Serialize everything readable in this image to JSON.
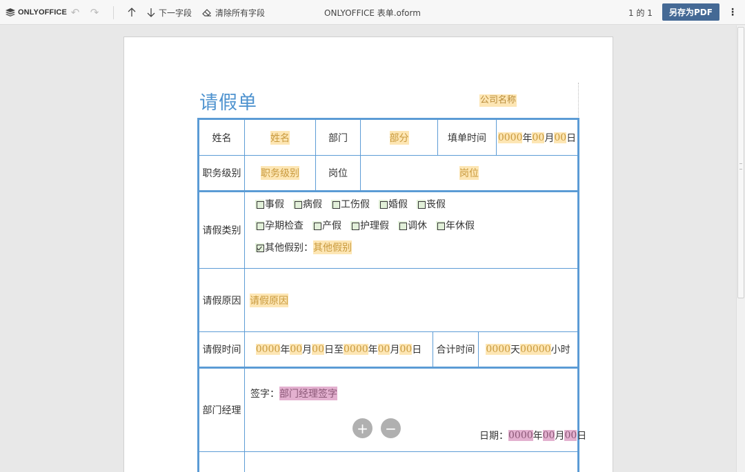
{
  "toolbar": {
    "logo_text": "ONLYOFFICE",
    "next_field": "下一字段",
    "clear_fields": "清除所有字段",
    "doc_title": "ONLYOFFICE 表单.oform",
    "pages": "1 的 1",
    "save_pdf": "另存为PDF"
  },
  "form": {
    "title": "请假单",
    "company": "公司名称",
    "labels": {
      "name": "姓名",
      "dept": "部门",
      "fill_time": "填单时间",
      "rank": "职务级别",
      "post": "岗位",
      "leave_type": "请假类别",
      "leave_reason": "请假原因",
      "leave_time": "请假时间",
      "total_time": "合计时间",
      "manager": "部门经理"
    },
    "fields": {
      "name": "姓名",
      "dept": "部分",
      "rank": "职务级别",
      "post": "岗位",
      "reason": "请假原因",
      "other_type": "其他假别",
      "manager_sign": "部门经理签字"
    },
    "fill_date": {
      "y": "0000",
      "yl": "年",
      "m": "00",
      "ml": "月",
      "d": "00",
      "dl": "日"
    },
    "leave_range": {
      "y1": "0000",
      "yl1": "年",
      "m1": "00",
      "ml1": "月",
      "d1": "00",
      "dl1": "日至",
      "y2": "0000",
      "yl2": "年",
      "m2": "00",
      "ml2": "月",
      "d2": "00",
      "dl2": "日"
    },
    "total": {
      "days": "0000",
      "dl": "天",
      "hours": "00000",
      "hl": "小时"
    },
    "checkboxes_row1": [
      "事假",
      "病假",
      "工伤假",
      "婚假",
      "丧假"
    ],
    "checkboxes_row2": [
      "孕期检查",
      "产假",
      "护理假",
      "调休",
      "年休假"
    ],
    "other_label": "其他假别：",
    "sign_label": "签字：",
    "date_label": "日期：",
    "sign_date": {
      "y": "0000",
      "yl": "年",
      "m": "00",
      "ml": "月",
      "d": "00",
      "dl": "日"
    }
  },
  "zoom": {
    "plus": "+",
    "minus": "−"
  }
}
